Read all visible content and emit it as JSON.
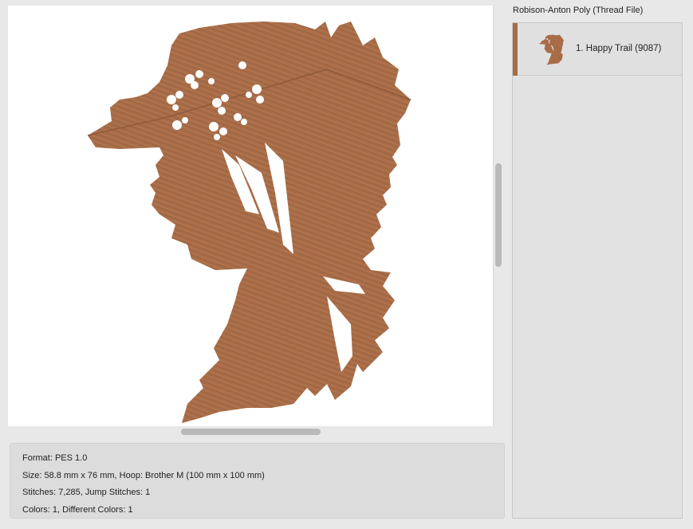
{
  "colors": {
    "thread": "#a86c47",
    "thread_dark": "#8f5a3a"
  },
  "preview": {
    "icon": "embroidery-silhouette-icon"
  },
  "info": {
    "format": "Format: PES 1.0",
    "size": "Size: 58.8 mm x 76 mm, Hoop: Brother M (100 mm x 100 mm)",
    "stitches": "Stitches: 7,285, Jump Stitches: 1",
    "colors": "Colors: 1, Different Colors: 1"
  },
  "thread_panel": {
    "title": "Robison-Anton Poly (Thread File)",
    "items": [
      {
        "label": "1. Happy Trail (9087)"
      }
    ]
  }
}
